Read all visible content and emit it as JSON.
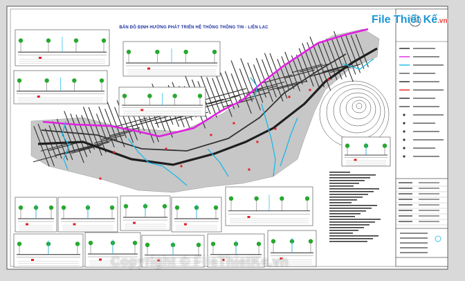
{
  "drawing": {
    "title": "BẢN ĐỒ ĐỊNH HƯỚNG PHÁT TRIỂN HỆ THỐNG THÔNG TIN - LIÊN LẠC"
  },
  "watermark": {
    "logo_main": "File Thiết Kế",
    "logo_suffix": ".vn",
    "copyright": "Copyright © FileThietKe.vn"
  },
  "colors": {
    "background": "#d9d9d9",
    "sheet": "#ffffff",
    "comm_line": "#e020e0",
    "water": "#1ab8e8",
    "road_fill": "#3a3a3a",
    "urban_fill": "#c8c8c8",
    "accent_red": "#e32020",
    "vegetation": "#27a82e"
  }
}
